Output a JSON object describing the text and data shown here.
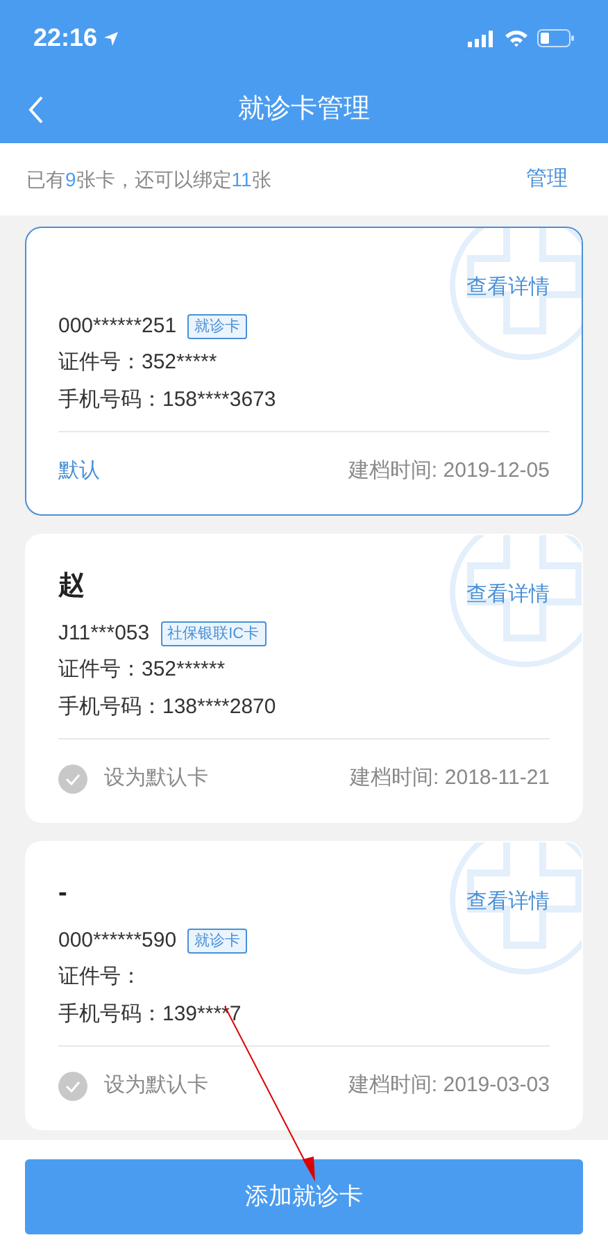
{
  "status_bar": {
    "time": "22:16"
  },
  "nav": {
    "title": "就诊卡管理"
  },
  "summary": {
    "text": "已有**9**张卡，还可以绑定**11**张",
    "action": "管理"
  },
  "cards": [
    {
      "number": "000******251",
      "tag": "就诊卡",
      "id_label": "证件号：",
      "id_value": "352*****",
      "phone_label": "手机号码：",
      "phone_value": "158****3673",
      "default": true,
      "default_text": "默认",
      "detail": "查看详情",
      "date": "建档时间: 2019-12-05"
    },
    {
      "name": "赵",
      "number": "J11***053",
      "tag": "社保银联IC卡",
      "id_label": "证件号：",
      "id_value": "352******",
      "phone_label": "手机号码：",
      "phone_value": "138****2870",
      "default": false,
      "default_text": "设为默认卡",
      "detail": "查看详情",
      "date": "建档时间: 2018-11-21"
    },
    {
      "name": "-",
      "number": "000******590",
      "tag": "就诊卡",
      "id_label": "证件号：",
      "phone_label": "手机号码：",
      "phone_value": "139****7",
      "default": false,
      "default_text": "设为默认卡",
      "detail": "查看详情",
      "date": "建档时间: 2019-03-03"
    }
  ],
  "add_button": "添加就诊卡"
}
